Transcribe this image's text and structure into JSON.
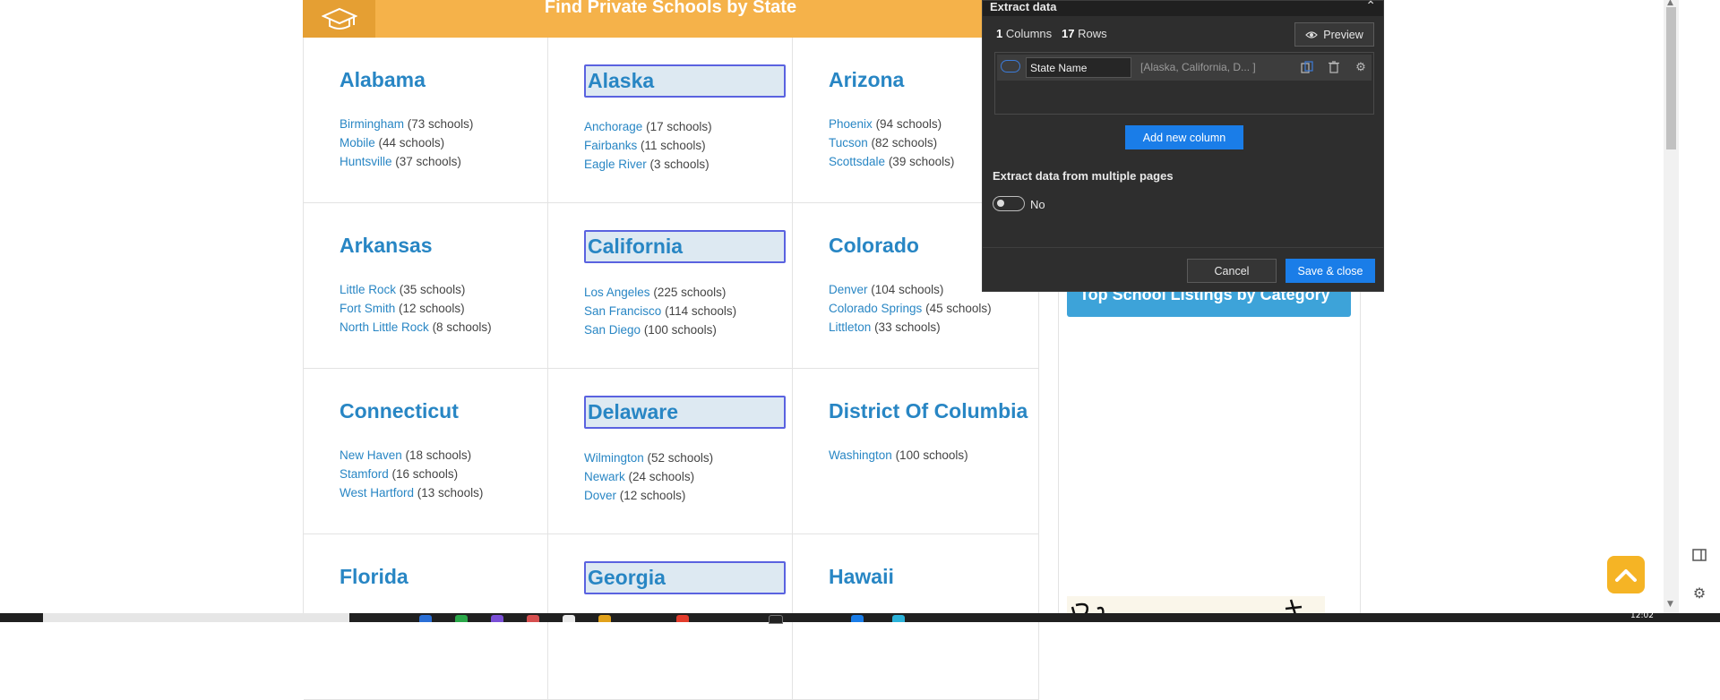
{
  "banner": {
    "title": "Find Private Schools by State"
  },
  "states": [
    {
      "name": "Alabama",
      "highlighted": false,
      "cities": [
        {
          "city": "Birmingham",
          "count": "(73 schools)"
        },
        {
          "city": "Mobile",
          "count": "(44 schools)"
        },
        {
          "city": "Huntsville",
          "count": "(37 schools)"
        }
      ]
    },
    {
      "name": "Alaska",
      "highlighted": true,
      "cities": [
        {
          "city": "Anchorage",
          "count": "(17 schools)"
        },
        {
          "city": "Fairbanks",
          "count": "(11 schools)"
        },
        {
          "city": "Eagle River",
          "count": "(3 schools)"
        }
      ]
    },
    {
      "name": "Arizona",
      "highlighted": false,
      "cities": [
        {
          "city": "Phoenix",
          "count": "(94 schools)"
        },
        {
          "city": "Tucson",
          "count": "(82 schools)"
        },
        {
          "city": "Scottsdale",
          "count": "(39 schools)"
        }
      ]
    },
    {
      "name": "Arkansas",
      "highlighted": false,
      "cities": [
        {
          "city": "Little Rock",
          "count": "(35 schools)"
        },
        {
          "city": "Fort Smith",
          "count": "(12 schools)"
        },
        {
          "city": "North Little Rock",
          "count": "(8 schools)"
        }
      ]
    },
    {
      "name": "California",
      "highlighted": true,
      "cities": [
        {
          "city": "Los Angeles",
          "count": "(225 schools)"
        },
        {
          "city": "San Francisco",
          "count": "(114 schools)"
        },
        {
          "city": "San Diego",
          "count": "(100 schools)"
        }
      ]
    },
    {
      "name": "Colorado",
      "highlighted": false,
      "cities": [
        {
          "city": "Denver",
          "count": "(104 schools)"
        },
        {
          "city": "Colorado Springs",
          "count": "(45 schools)"
        },
        {
          "city": "Littleton",
          "count": "(33 schools)"
        }
      ]
    },
    {
      "name": "Connecticut",
      "highlighted": false,
      "cities": [
        {
          "city": "New Haven",
          "count": "(18 schools)"
        },
        {
          "city": "Stamford",
          "count": "(16 schools)"
        },
        {
          "city": "West Hartford",
          "count": "(13 schools)"
        }
      ]
    },
    {
      "name": "Delaware",
      "highlighted": true,
      "cities": [
        {
          "city": "Wilmington",
          "count": "(52 schools)"
        },
        {
          "city": "Newark",
          "count": "(24 schools)"
        },
        {
          "city": "Dover",
          "count": "(12 schools)"
        }
      ]
    },
    {
      "name": "District Of Columbia",
      "highlighted": false,
      "cities": [
        {
          "city": "Washington",
          "count": "(100 schools)"
        }
      ]
    },
    {
      "name": "Florida",
      "highlighted": false,
      "cities": []
    },
    {
      "name": "Georgia",
      "highlighted": true,
      "cities": []
    },
    {
      "name": "Hawaii",
      "highlighted": false,
      "cities": []
    }
  ],
  "sidebar": {
    "category_title": "Top School Listings by Category"
  },
  "panel": {
    "title": "Extract data",
    "columns_count": "1",
    "columns_label": "Columns",
    "rows_count": "17",
    "rows_label": "Rows",
    "preview_label": "Preview",
    "column": {
      "name": "State Name",
      "sample": "[Alaska, California, D... ]"
    },
    "add_column_label": "Add new column",
    "multi_pages_label": "Extract data from multiple pages",
    "multi_pages_toggle": "No",
    "cancel_label": "Cancel",
    "save_label": "Save & close"
  },
  "taskbar": {
    "clock": "12:02"
  },
  "colors": {
    "accent_blue": "#1a7de8",
    "link_blue": "#2886c4",
    "banner_orange": "#f5b24a",
    "panel_bg": "#2e2e2e"
  }
}
